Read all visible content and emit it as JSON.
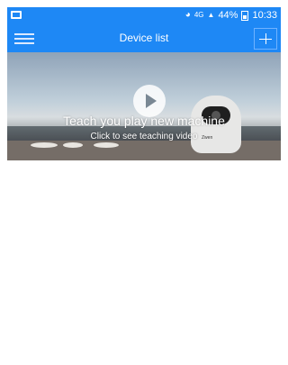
{
  "status_bar": {
    "battery": "44%",
    "time": "10:33",
    "network": "4G",
    "icons": [
      "notification-icon",
      "wifi-icon",
      "signal-icon",
      "battery-icon"
    ]
  },
  "app_bar": {
    "title": "Device list",
    "menu_icon": "menu-icon",
    "add_icon": "plus-icon"
  },
  "banner": {
    "title": "Teach you play new machine",
    "subtitle": "Click to see teaching video",
    "play_icon": "play-icon",
    "camera_brand": "Zwen"
  },
  "colors": {
    "primary": "#1e88f5",
    "background": "#ffffff"
  }
}
